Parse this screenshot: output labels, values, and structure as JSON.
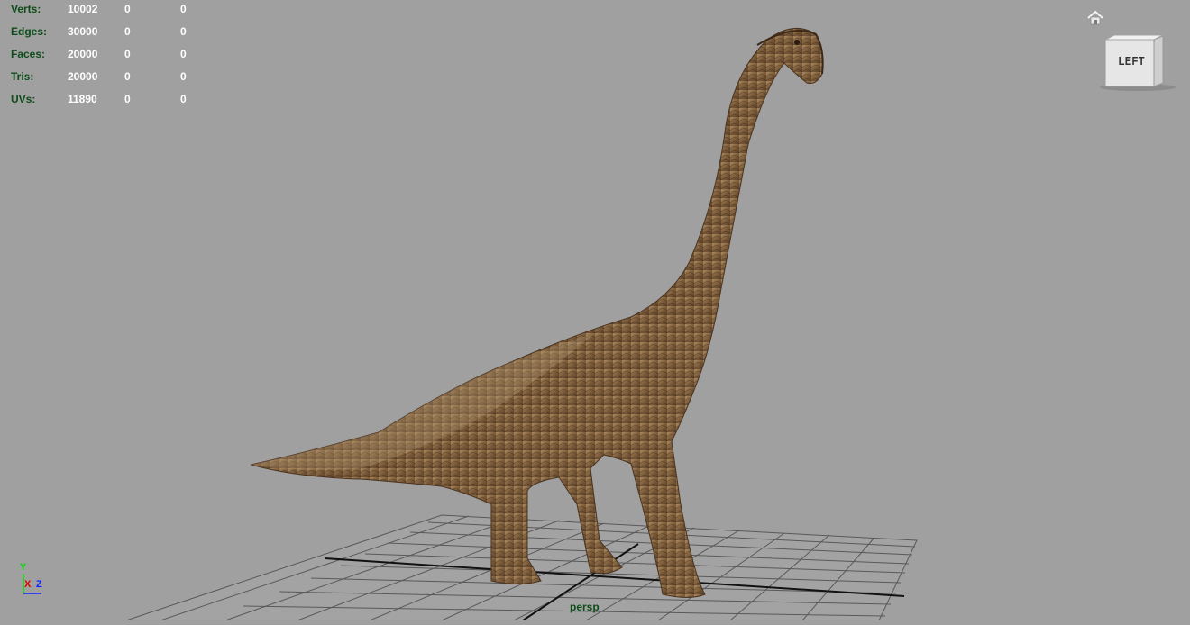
{
  "hud": {
    "rows": [
      {
        "label": "Verts:",
        "c1": "10002",
        "c2": "0",
        "c3": "0"
      },
      {
        "label": "Edges:",
        "c1": "30000",
        "c2": "0",
        "c3": "0"
      },
      {
        "label": "Faces:",
        "c1": "20000",
        "c2": "0",
        "c3": "0"
      },
      {
        "label": "Tris:",
        "c1": "20000",
        "c2": "0",
        "c3": "0"
      },
      {
        "label": "UVs:",
        "c1": "11890",
        "c2": "0",
        "c3": "0"
      }
    ]
  },
  "viewcube": {
    "face_label": "LEFT"
  },
  "camera": {
    "name": "persp"
  },
  "axis": {
    "x": "X",
    "y": "Y",
    "z": "Z"
  },
  "icons": {
    "home": "home-icon"
  },
  "colors": {
    "background": "#a0a0a0",
    "hud_label": "#0e4d1a",
    "hud_value": "#ffffff",
    "grid": "#5a5a5a",
    "model": "#8a6a45"
  }
}
